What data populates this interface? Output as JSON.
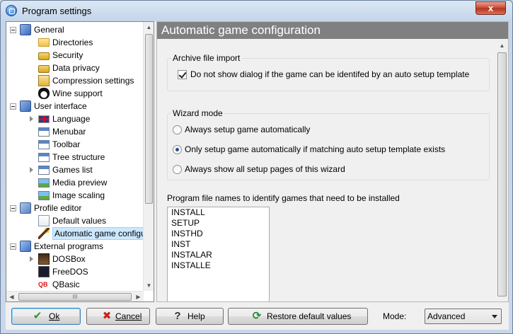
{
  "window": {
    "title": "Program settings",
    "close_glyph": "x"
  },
  "tree": {
    "nodes": [
      {
        "label": "General",
        "icon": "general-settings-icon",
        "level": 0,
        "expanded": true
      },
      {
        "label": "Directories",
        "icon": "folder-icon",
        "level": 1
      },
      {
        "label": "Security",
        "icon": "lock-icon",
        "level": 1
      },
      {
        "label": "Data privacy",
        "icon": "lock-icon",
        "level": 1
      },
      {
        "label": "Compression settings",
        "icon": "archive-icon",
        "level": 1
      },
      {
        "label": "Wine support",
        "icon": "penguin-icon",
        "level": 1
      },
      {
        "label": "User interface",
        "icon": "user-interface-icon",
        "level": 0,
        "expanded": true
      },
      {
        "label": "Language",
        "icon": "uk-flag-icon",
        "level": 1,
        "has_children": true
      },
      {
        "label": "Menubar",
        "icon": "menubar-icon",
        "level": 1
      },
      {
        "label": "Toolbar",
        "icon": "toolbar-icon",
        "level": 1
      },
      {
        "label": "Tree structure",
        "icon": "tree-icon",
        "level": 1
      },
      {
        "label": "Games list",
        "icon": "list-icon",
        "level": 1,
        "has_children": true
      },
      {
        "label": "Media preview",
        "icon": "image-icon",
        "level": 1
      },
      {
        "label": "Image scaling",
        "icon": "image-icon",
        "level": 1
      },
      {
        "label": "Profile editor",
        "icon": "profile-editor-icon",
        "level": 0,
        "expanded": true
      },
      {
        "label": "Default values",
        "icon": "default-values-icon",
        "level": 1
      },
      {
        "label": "Automatic game configuration",
        "icon": "wand-icon",
        "level": 1,
        "selected": true
      },
      {
        "label": "External programs",
        "icon": "external-programs-icon",
        "level": 0,
        "expanded": true
      },
      {
        "label": "DOSBox",
        "icon": "dosbox-icon",
        "level": 1,
        "has_children": true
      },
      {
        "label": "FreeDOS",
        "icon": "freedos-icon",
        "level": 1
      },
      {
        "label": "QBasic",
        "icon": "qbasic-icon",
        "level": 1
      }
    ],
    "hscroll_grip": "III"
  },
  "page": {
    "title": "Automatic game configuration",
    "archive_group": {
      "label": "Archive file import",
      "checkbox_label": "Do not show dialog if the game can be identifed by an auto setup template",
      "checked": true
    },
    "wizard_group": {
      "label": "Wizard mode",
      "options": [
        {
          "label": "Always setup game automatically",
          "selected": false
        },
        {
          "label": "Only setup game automatically if matching auto setup template exists",
          "selected": true
        },
        {
          "label": "Always show all setup pages of this wizard",
          "selected": false
        }
      ]
    },
    "filenames_label": "Program file names to identify games that need to be installed",
    "filenames": [
      "INSTALL",
      "SETUP",
      "INSTHD",
      "INST",
      "INSTALAR",
      "INSTALLE"
    ]
  },
  "buttons": {
    "ok": "Ok",
    "cancel": "Cancel",
    "help": "Help",
    "restore": "Restore default values"
  },
  "mode": {
    "label": "Mode:",
    "selected": "Advanced"
  },
  "colors": {
    "header_bg": "#808080",
    "selection": "#cce8ff"
  }
}
